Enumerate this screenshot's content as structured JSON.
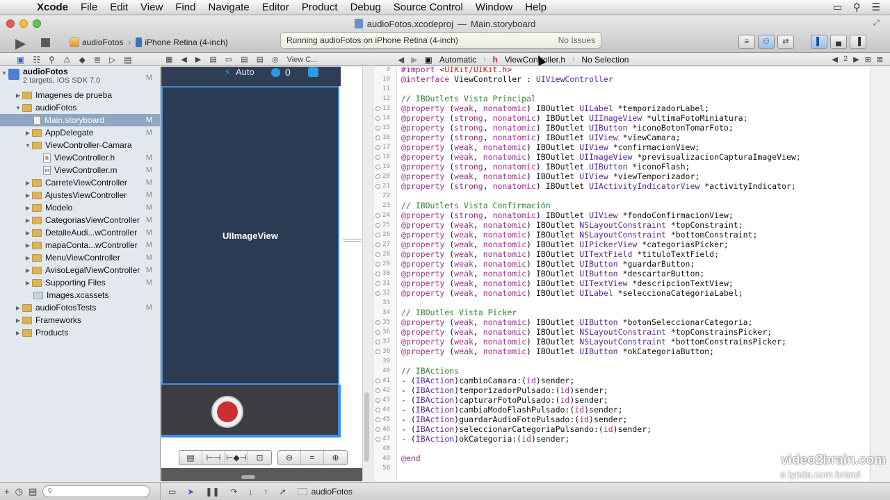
{
  "menubar": {
    "app": "Xcode",
    "items": [
      "File",
      "Edit",
      "View",
      "Find",
      "Navigate",
      "Editor",
      "Product",
      "Debug",
      "Source Control",
      "Window",
      "Help"
    ]
  },
  "window": {
    "title_project": "audioFotos.xcodeproj",
    "title_sep": "—",
    "title_file": "Main.storyboard"
  },
  "toolbar": {
    "scheme": "audioFotos",
    "device": "iPhone Retina (4-inch)",
    "activity": "Running audioFotos on iPhone Retina (4-inch)",
    "issues": "No Issues"
  },
  "navigator": {
    "items": [
      {
        "label": "audioFotos",
        "sub": "2 targets, iOS SDK 7.0",
        "badge": "M"
      },
      {
        "label": "Imagenes de prueba",
        "badge": ""
      },
      {
        "label": "audioFotos",
        "badge": ""
      },
      {
        "label": "Main.storyboard",
        "badge": "M"
      },
      {
        "label": "AppDelegate",
        "badge": "M"
      },
      {
        "label": "ViewController-Camara",
        "badge": ""
      },
      {
        "label": "ViewController.h",
        "badge": "M"
      },
      {
        "label": "ViewController.m",
        "badge": "M"
      },
      {
        "label": "CarreteViewController",
        "badge": "M"
      },
      {
        "label": "AjustesViewController",
        "badge": "M"
      },
      {
        "label": "Modelo",
        "badge": "M"
      },
      {
        "label": "CategoriasViewController",
        "badge": "M"
      },
      {
        "label": "DetalleAudi...wController",
        "badge": "M"
      },
      {
        "label": "mapaConta...wController",
        "badge": "M"
      },
      {
        "label": "MenuViewController",
        "badge": "M"
      },
      {
        "label": "AvisoLegalViewController",
        "badge": "M"
      },
      {
        "label": "Supporting Files",
        "badge": "M"
      },
      {
        "label": "Images.xcassets",
        "badge": ""
      },
      {
        "label": "audioFotosTests",
        "badge": "M"
      },
      {
        "label": "Frameworks",
        "badge": ""
      },
      {
        "label": "Products",
        "badge": ""
      }
    ]
  },
  "jumpbar_left": {
    "crumb": "View C..."
  },
  "jumpbar_right": {
    "mode": "Automatic",
    "file": "ViewController.h",
    "selection": "No Selection",
    "counter": "2"
  },
  "canvas": {
    "auto_label": "Auto",
    "count_label": "0",
    "imageview_label": "UIImageView"
  },
  "editor": {
    "lines": [
      {
        "n": "9",
        "text": "#import <UIKit/UIKit.h>"
      },
      {
        "n": "10",
        "text": "@interface ViewController : UIViewController"
      },
      {
        "n": "11",
        "text": ""
      },
      {
        "n": "12",
        "text": "// IBOutlets Vista Principal"
      },
      {
        "n": "13",
        "text": "@property (weak, nonatomic) IBOutlet UILabel *temporizadorLabel;"
      },
      {
        "n": "14",
        "text": "@property (strong, nonatomic) IBOutlet UIImageView *ultimaFotoMiniatura;"
      },
      {
        "n": "15",
        "text": "@property (strong, nonatomic) IBOutlet UIButton *iconoBotonTomarFoto;"
      },
      {
        "n": "16",
        "text": "@property (strong, nonatomic) IBOutlet UIView *viewCamara;"
      },
      {
        "n": "17",
        "text": "@property (weak, nonatomic) IBOutlet UIView *confirmacionView;"
      },
      {
        "n": "18",
        "text": "@property (weak, nonatomic) IBOutlet UIImageView *previsualizacionCapturaImageView;"
      },
      {
        "n": "19",
        "text": "@property (strong, nonatomic) IBOutlet UIButton *iconoFlash;"
      },
      {
        "n": "20",
        "text": "@property (weak, nonatomic) IBOutlet UIView *viewTemporizador;"
      },
      {
        "n": "21",
        "text": "@property (strong, nonatomic) IBOutlet UIActivityIndicatorView *activityIndicator;"
      },
      {
        "n": "22",
        "text": ""
      },
      {
        "n": "23",
        "text": "// IBOutlets Vista Confirmación"
      },
      {
        "n": "24",
        "text": "@property (strong, nonatomic) IBOutlet UIView *fondoConfirmacionView;"
      },
      {
        "n": "25",
        "text": "@property (weak, nonatomic) IBOutlet NSLayoutConstraint *topConstraint;"
      },
      {
        "n": "26",
        "text": "@property (weak, nonatomic) IBOutlet NSLayoutConstraint *bottomConstraint;"
      },
      {
        "n": "27",
        "text": "@property (weak, nonatomic) IBOutlet UIPickerView *categoriasPicker;"
      },
      {
        "n": "28",
        "text": "@property (weak, nonatomic) IBOutlet UITextField *tituloTextField;"
      },
      {
        "n": "29",
        "text": "@property (weak, nonatomic) IBOutlet UIButton *guardarButton;"
      },
      {
        "n": "30",
        "text": "@property (weak, nonatomic) IBOutlet UIButton *descartarButton;"
      },
      {
        "n": "31",
        "text": "@property (weak, nonatomic) IBOutlet UITextView *descripcionTextView;"
      },
      {
        "n": "32",
        "text": "@property (weak, nonatomic) IBOutlet UILabel *seleccionaCategoriaLabel;"
      },
      {
        "n": "33",
        "text": ""
      },
      {
        "n": "34",
        "text": "// IBOutles Vista Picker"
      },
      {
        "n": "35",
        "text": "@property (weak, nonatomic) IBOutlet UIButton *botonSeleccionarCategoria;"
      },
      {
        "n": "36",
        "text": "@property (weak, nonatomic) IBOutlet NSLayoutConstraint *topConstrainsPicker;"
      },
      {
        "n": "37",
        "text": "@property (weak, nonatomic) IBOutlet NSLayoutConstraint *bottomConstrainsPicker;"
      },
      {
        "n": "38",
        "text": "@property (weak, nonatomic) IBOutlet UIButton *okCategoriaButton;"
      },
      {
        "n": "39",
        "text": ""
      },
      {
        "n": "40",
        "text": "// IBActions"
      },
      {
        "n": "41",
        "text": "- (IBAction)cambioCamara:(id)sender;"
      },
      {
        "n": "42",
        "text": "- (IBAction)temporizadorPulsado:(id)sender;"
      },
      {
        "n": "43",
        "text": "- (IBAction)capturarFotoPulsado:(id)sender;"
      },
      {
        "n": "44",
        "text": "- (IBAction)cambiaModoFlashPulsado:(id)sender;"
      },
      {
        "n": "45",
        "text": "- (IBAction)guardarAudioFotoPulsado:(id)sender;"
      },
      {
        "n": "46",
        "text": "- (IBAction)seleccionarCategoriaPulsando:(id)sender;"
      },
      {
        "n": "47",
        "text": "- (IBAction)okCategoria:(id)sender;"
      },
      {
        "n": "48",
        "text": ""
      },
      {
        "n": "49",
        "text": "@end"
      },
      {
        "n": "50",
        "text": ""
      }
    ]
  },
  "debugbar": {
    "target": "audioFotos"
  },
  "watermark": {
    "line1": "video2brain.com",
    "line2": "a lynda.com brand"
  },
  "colors": {
    "accent": "#3e8be8",
    "selection": "#8fa6c2",
    "record": "#cd2f2f"
  }
}
